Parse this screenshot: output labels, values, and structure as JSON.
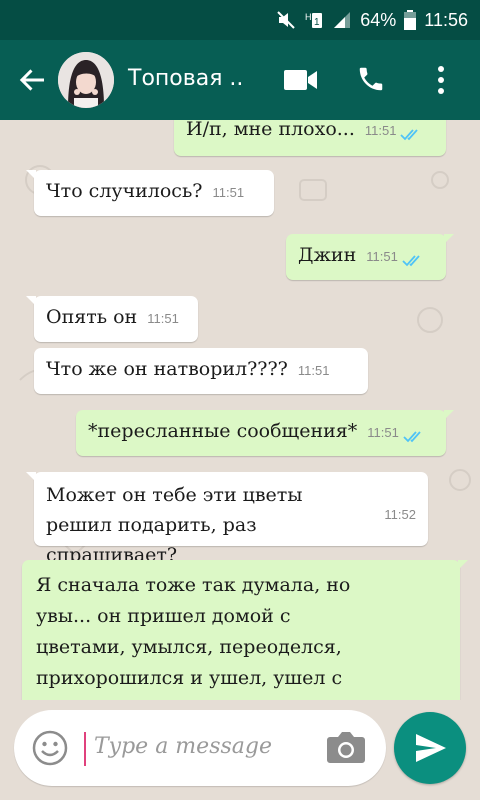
{
  "status_bar": {
    "battery_percent": "64%",
    "time": "11:56"
  },
  "header": {
    "contact_name": "Топовая ..",
    "icons": [
      "back-arrow-icon",
      "avatar",
      "video-call-icon",
      "phone-icon",
      "more-vert-icon"
    ]
  },
  "messages": [
    {
      "direction": "out",
      "text": "И/п, мне плохо...",
      "time": "11:51",
      "read": true
    },
    {
      "direction": "in",
      "text": "Что случилось?",
      "time": "11:51"
    },
    {
      "direction": "out",
      "text": "Джин",
      "time": "11:51",
      "read": true
    },
    {
      "direction": "in",
      "text": "Опять он",
      "time": "11:51"
    },
    {
      "direction": "in",
      "text": "Что же он натворил????",
      "time": "11:51"
    },
    {
      "direction": "out",
      "text": "*пересланные сообщения*",
      "time": "11:51",
      "read": true
    },
    {
      "direction": "in",
      "text": "Может он тебе эти цветы решил подарить, раз спрашивает?",
      "time": "11:52"
    },
    {
      "direction": "out",
      "text": "Я сначала тоже так думала, но увы... он пришел домой с цветами, умылся, переоделся, прихорошился и ушел, ушел с цветами. Думаю тут все...",
      "time": ""
    }
  ],
  "input": {
    "placeholder": "Type a message"
  },
  "colors": {
    "header": "#075e54",
    "status_bar": "#054d44",
    "outgoing_bubble": "#dcf8c6",
    "incoming_bubble": "#ffffff",
    "send_button": "#0b8f7f",
    "read_ticks": "#4fc3f7"
  }
}
